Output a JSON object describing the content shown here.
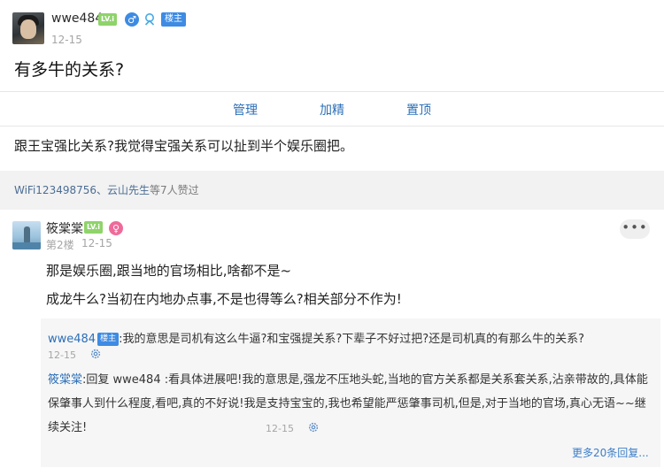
{
  "post": {
    "author": "wwe484",
    "level": "LV.i",
    "owner_badge": "楼主",
    "time": "12-15",
    "title": "有多牛的关系?",
    "body": "跟王宝强比关系?我觉得宝强关系可以扯到半个娱乐圈把。"
  },
  "admin_actions": [
    "管理",
    "加精",
    "置顶"
  ],
  "likes": {
    "users": "WiFi123498756、云山先生",
    "suffix": "等7人赞过"
  },
  "floor": {
    "author": "筱棠棠",
    "level": "LV.i",
    "floor_label": "第2楼",
    "time": "12-15",
    "more_label": "•••",
    "lines": [
      "那是娱乐圈,跟当地的官场相比,啥都不是~",
      "成龙牛么?当初在内地办点事,不是也得等么?相关部分不作为!"
    ]
  },
  "sub_replies": [
    {
      "author": "wwe484",
      "badge": "楼主",
      "text": ":我的意思是司机有这么牛逼?和宝强提关系?下辈子不好过把?还是司机真的有那么牛的关系?",
      "time": "12-15"
    },
    {
      "author": "筱棠棠",
      "text": ":回复 wwe484 :看具体进展吧!我的意思是,强龙不压地头蛇,当地的官方关系都是关系套关系,沾亲带故的,具体能保肇事人到什么程度,看吧,真的不好说!我是支持宝宝的,我也希望能严惩肇事司机,但是,对于当地的官场,真心无语~~继续关注!",
      "time": "12-15"
    }
  ],
  "more_replies": "更多20条回复...",
  "colors": {
    "link": "#2c6fb7",
    "owner_badge": "#3d8be3",
    "level_badge": "#8fd36b",
    "male": "#3d8be3",
    "female": "#ef6a9a"
  },
  "icons": [
    "male-icon",
    "vip-icon",
    "female-icon",
    "settings-icon",
    "more-icon"
  ]
}
